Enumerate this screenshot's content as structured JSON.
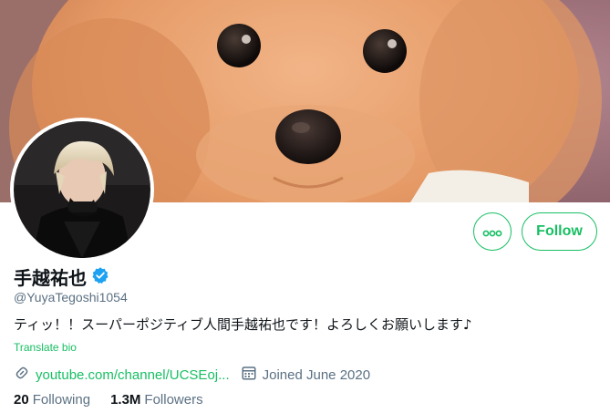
{
  "profile": {
    "display_name": "手越祐也",
    "handle": "@YuyaTegoshi1054",
    "bio": "ティッ！！スーパーポジティブ人間手越祐也です！よろしくお願いします♪",
    "translate_label": "Translate bio",
    "link_text": "youtube.com/channel/UCSEoj...",
    "joined_text": "Joined June 2020",
    "verified": true
  },
  "actions": {
    "follow_label": "Follow"
  },
  "stats": {
    "following_count": "20",
    "following_label": "Following",
    "followers_count": "1.3M",
    "followers_label": "Followers"
  },
  "icons": {
    "more": "more-options-icon",
    "verified": "verified-badge-icon",
    "link": "link-icon",
    "calendar": "calendar-icon"
  },
  "colors": {
    "accent": "#17bf63",
    "verified": "#1da1f2",
    "secondary_text": "#5b7083",
    "primary_text": "#0f1419"
  }
}
